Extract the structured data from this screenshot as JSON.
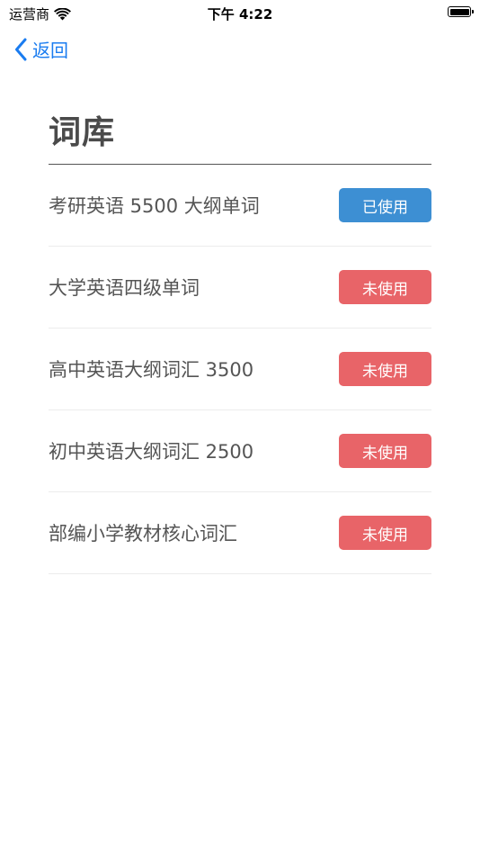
{
  "status_bar": {
    "carrier": "运营商",
    "time": "下午 4:22"
  },
  "nav": {
    "back_label": "返回"
  },
  "page": {
    "title": "词库"
  },
  "colors": {
    "used": "#3d8fd3",
    "unused": "#e86468",
    "back": "#1a7cf0"
  },
  "wordbanks": [
    {
      "name": "考研英语 5500 大纲单词",
      "status": "已使用",
      "state": "used"
    },
    {
      "name": "大学英语四级单词",
      "status": "未使用",
      "state": "unused"
    },
    {
      "name": "高中英语大纲词汇 3500",
      "status": "未使用",
      "state": "unused"
    },
    {
      "name": "初中英语大纲词汇 2500",
      "status": "未使用",
      "state": "unused"
    },
    {
      "name": "部编小学教材核心词汇",
      "status": "未使用",
      "state": "unused"
    }
  ]
}
